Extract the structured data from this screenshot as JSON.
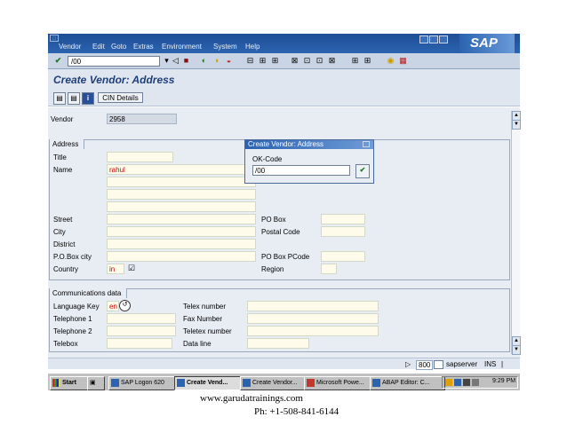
{
  "menu": {
    "items": [
      "Vendor",
      "Edit",
      "Goto",
      "Extras",
      "Environment",
      "System",
      "Help"
    ],
    "logo": "SAP"
  },
  "toolbar": {
    "command_value": "/00"
  },
  "screen": {
    "title": "Create Vendor: Address",
    "cin_button": "CIN Details"
  },
  "vendor": {
    "label": "Vendor",
    "value": "2958"
  },
  "address": {
    "frame_title": "Address",
    "title_label": "Title",
    "name_label": "Name",
    "name_value": "rahul",
    "street_label": "Street",
    "city_label": "City",
    "district_label": "District",
    "pobox_city_label": "P.O.Box city",
    "country_label": "Country",
    "country_value": "in",
    "pobox_label": "PO Box",
    "postal_code_label": "Postal Code",
    "pobox_pcode_label": "PO Box PCode",
    "region_label": "Region"
  },
  "comms": {
    "frame_title": "Communications data",
    "language_label": "Language Key",
    "language_value": "en",
    "telephone1_label": "Telephone 1",
    "telephone2_label": "Telephone 2",
    "telebox_label": "Telebox",
    "telex_label": "Telex number",
    "fax_label": "Fax Number",
    "teletex_label": "Teletex number",
    "dataline_label": "Data line"
  },
  "popup": {
    "title": "Create Vendor: Address",
    "okcode_label": "OK-Code",
    "okcode_value": "/00"
  },
  "status": {
    "session": "800",
    "server": "sapserver",
    "mode": "INS"
  },
  "taskbar": {
    "start": "Start",
    "tasks": [
      "SAP Logon 620",
      "Create Vend...",
      "Create Vendor...",
      "Microsoft Powe...",
      "ABAP Editor: C..."
    ],
    "clock": "9:29 PM"
  },
  "footer": {
    "website": "www.garudatrainings.com",
    "phone": "Ph: +1-508-841-6144"
  },
  "colors": {
    "title_blue": "#1f3f77",
    "menubar_blue": "#2b63b0",
    "input_yellow": "#fffbea",
    "name_red": "#cc0000"
  }
}
